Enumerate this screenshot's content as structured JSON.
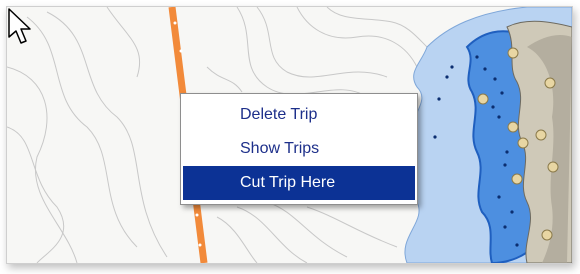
{
  "map": {
    "route_color": "#f28a3a",
    "water_color": "#b9d3f2",
    "deep_water_color": "#2e78d6",
    "land_color": "#cfc9b8",
    "waypoint_color": "#e8d6a3"
  },
  "context_menu": {
    "items": [
      {
        "label": "Delete Trip",
        "selected": false
      },
      {
        "label": "Show Trips",
        "selected": false
      },
      {
        "label": "Cut Trip Here",
        "selected": true
      }
    ]
  },
  "cursor": {
    "icon": "arrow-pointer-icon"
  }
}
